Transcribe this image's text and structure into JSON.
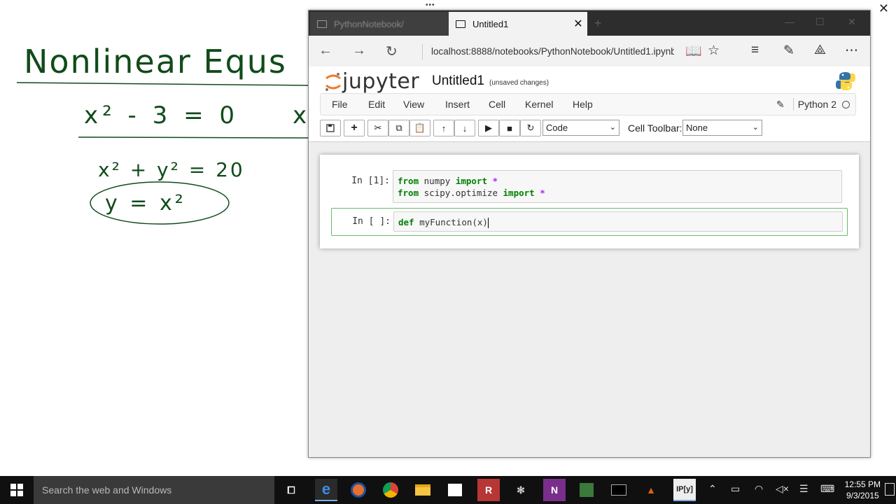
{
  "whiteboard": {
    "title": "Nonlinear Equs",
    "eq1": "x² - 3 = 0",
    "eq1_partial": "x",
    "eq2": "x² + y² = 20",
    "eq3": "y = x²"
  },
  "browser": {
    "tabs": [
      {
        "label": "PythonNotebook/",
        "active": false
      },
      {
        "label": "Untitled1",
        "active": true
      }
    ],
    "address": "localhost:8888/notebooks/PythonNotebook/Untitled1.ipynb"
  },
  "jupyter": {
    "logo_text": "jupyter",
    "notebook_title": "Untitled1",
    "save_status": "(unsaved changes)",
    "menu": [
      "File",
      "Edit",
      "View",
      "Insert",
      "Cell",
      "Kernel",
      "Help"
    ],
    "kernel_name": "Python 2",
    "cell_type": "Code",
    "cell_toolbar_label": "Cell Toolbar:",
    "cell_toolbar_value": "None",
    "cells": [
      {
        "prompt": "In [1]:",
        "lines": [
          {
            "kw1": "from",
            "mod": "numpy",
            "kw2": "import",
            "star": "*"
          },
          {
            "kw1": "from",
            "mod": "scipy.optimize",
            "kw2": "import",
            "star": "*"
          }
        ]
      },
      {
        "prompt": "In [ ]:",
        "kw": "def",
        "name": "myFunction",
        "args": "(x)"
      }
    ]
  },
  "taskbar": {
    "search_placeholder": "Search the web and Windows",
    "time": "12:55 PM",
    "date": "9/3/2015",
    "apps": [
      "task-view",
      "edge",
      "firefox",
      "chrome",
      "file-explorer",
      "store",
      "r",
      "rstudio-ant",
      "onenote",
      "gnumeric",
      "terminal",
      "matlab",
      "ipython"
    ]
  },
  "colors": {
    "ink": "#114b1a",
    "keyword": "#008000",
    "operator": "#aa22ff",
    "taskbar": "#101010"
  }
}
